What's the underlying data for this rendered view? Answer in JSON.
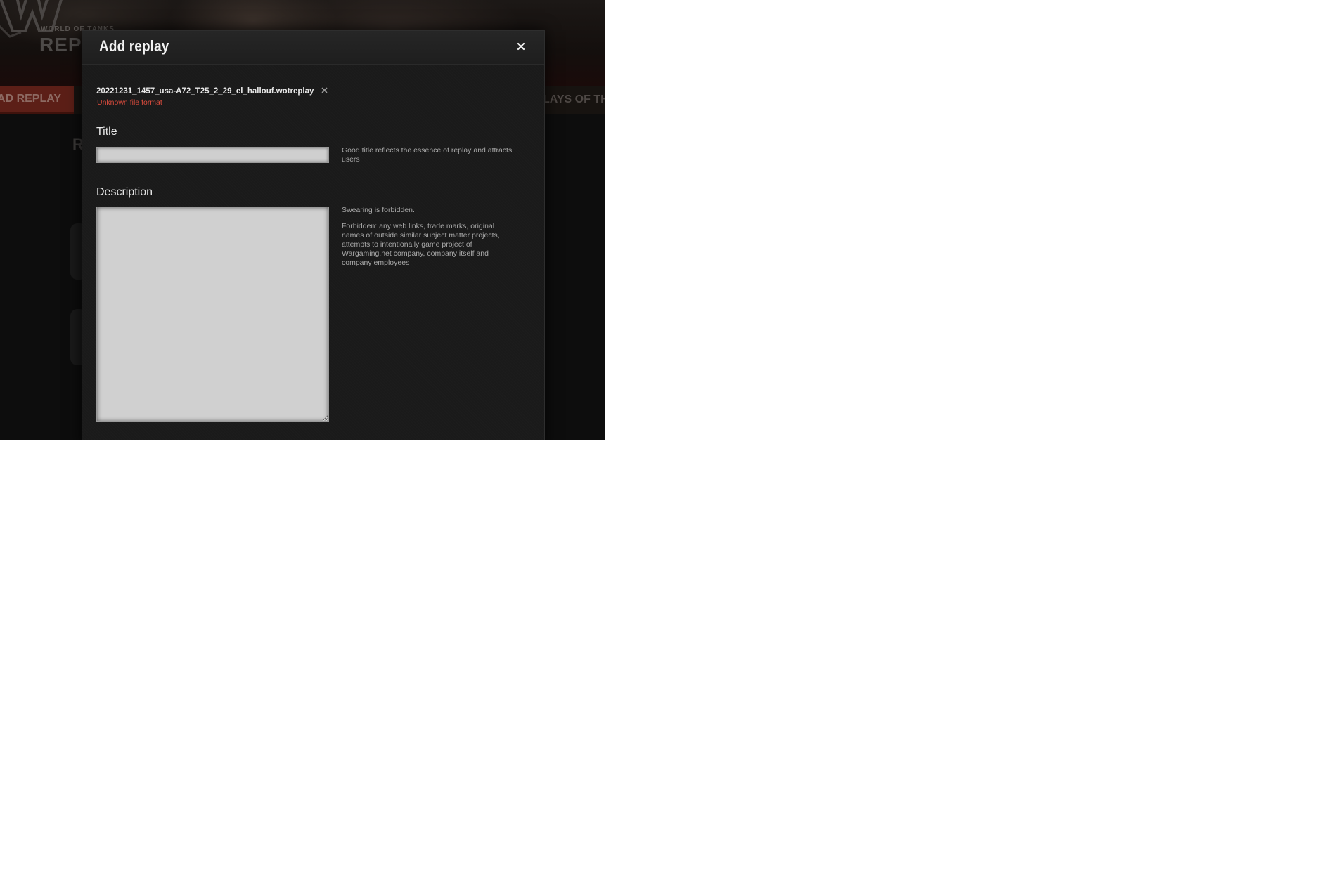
{
  "background": {
    "logo_small": "WORLD OF TANKS",
    "logo_big": "REPL",
    "upload_button": "OAD REPLAY",
    "nav_item": "LAYS OF TH",
    "heading": "R"
  },
  "modal": {
    "title": "Add replay",
    "close_icon": "close-icon",
    "file": {
      "name": "20221231_1457_usa-A72_T25_2_29_el_hallouf.wotreplay",
      "remove_icon": "close-icon",
      "error": "Unknown file format"
    },
    "title_field": {
      "label": "Title",
      "value": "",
      "hint": "Good title reflects the essence of replay and attracts users"
    },
    "description_field": {
      "label": "Description",
      "value": "",
      "hint_swearing": "Swearing is forbidden.",
      "hint_forbidden": "Forbidden: any web links, trade marks, original names of outside similar subject matter projects, attempts to intentionally game project of Wargaming.net company, company itself and company employees"
    }
  },
  "colors": {
    "modal_bg": "#1a1a1a",
    "error": "#d94b3c",
    "accent_red": "#5c1f17",
    "input_bg": "#cfcfcf"
  }
}
